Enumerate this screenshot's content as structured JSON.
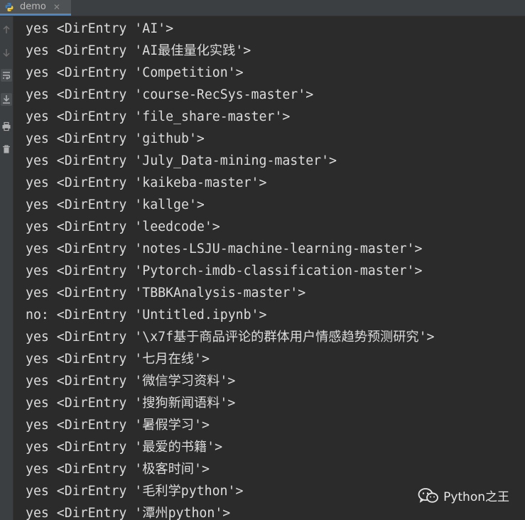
{
  "tab": {
    "label": "demo",
    "close_glyph": "✕"
  },
  "toolbar": {
    "icons": [
      "up-arrow-icon",
      "down-arrow-icon",
      "soft-wrap-icon",
      "scroll-to-end-icon",
      "print-icon",
      "trash-icon"
    ]
  },
  "console": {
    "lines": [
      "yes <DirEntry 'AI'>",
      "yes <DirEntry 'AI最佳量化实践'>",
      "yes <DirEntry 'Competition'>",
      "yes <DirEntry 'course-RecSys-master'>",
      "yes <DirEntry 'file_share-master'>",
      "yes <DirEntry 'github'>",
      "yes <DirEntry 'July_Data-mining-master'>",
      "yes <DirEntry 'kaikeba-master'>",
      "yes <DirEntry 'kallge'>",
      "yes <DirEntry 'leedcode'>",
      "yes <DirEntry 'notes-LSJU-machine-learning-master'>",
      "yes <DirEntry 'Pytorch-imdb-classification-master'>",
      "yes <DirEntry 'TBBKAnalysis-master'>",
      "no: <DirEntry 'Untitled.ipynb'>",
      "yes <DirEntry '\\x7f基于商品评论的群体用户情感趋势预测研究'>",
      "yes <DirEntry '七月在线'>",
      "yes <DirEntry '微信学习资料'>",
      "yes <DirEntry '搜狗新闻语料'>",
      "yes <DirEntry '暑假学习'>",
      "yes <DirEntry '最爱的书籍'>",
      "yes <DirEntry '极客时间'>",
      "yes <DirEntry '毛利学python'>",
      "yes <DirEntry '潭州python'>"
    ]
  },
  "watermark": {
    "text": "Python之王",
    "icon": "wechat-icon"
  }
}
